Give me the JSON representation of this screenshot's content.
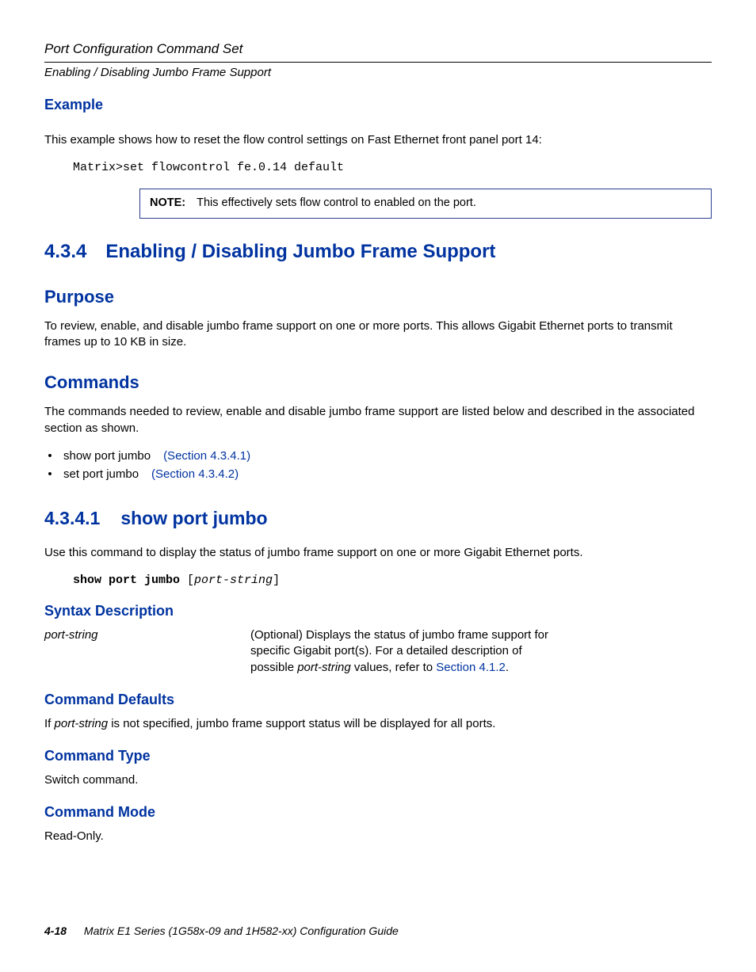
{
  "header": {
    "running_title": "Port Configuration Command Set",
    "running_sub": "Enabling / Disabling Jumbo Frame Support"
  },
  "example": {
    "heading": "Example",
    "text": "This example shows how to reset the flow control settings on Fast Ethernet front panel port 14:",
    "code": "Matrix>set flowcontrol fe.0.14 default",
    "note_label": "NOTE:",
    "note_body": "This effectively sets flow control to enabled on the port."
  },
  "section": {
    "num": "4.3.4",
    "title": "Enabling / Disabling Jumbo Frame Support"
  },
  "purpose": {
    "heading": "Purpose",
    "text": "To review, enable, and disable jumbo frame support on one or more ports. This allows Gigabit Ethernet ports to transmit frames up to 10 KB in size."
  },
  "commands": {
    "heading": "Commands",
    "intro": "The commands needed to review, enable and disable jumbo frame support are listed below and described in the associated section as shown.",
    "items": [
      {
        "bullet": "•",
        "text": "show port jumbo",
        "xref": "(Section 4.3.4.1)"
      },
      {
        "bullet": "•",
        "text": "set port jumbo",
        "xref": "(Section 4.3.4.2)"
      }
    ]
  },
  "cmd": {
    "num": "4.3.4.1",
    "title": "show port jumbo",
    "desc": "Use this command to display the status of jumbo frame support on one or more Gigabit Ethernet ports.",
    "syntax": "show port jumbo [port-string]"
  },
  "syntax_description": {
    "heading": "Syntax Description",
    "param": "port-string",
    "param_desc_l1": "(Optional) Displays the status of jumbo frame support for",
    "param_desc_l2": "specific Gigabit port(s). For a detailed description of",
    "param_desc_l3_a": "possible ",
    "param_desc_l3_i": "port-string",
    "param_desc_l3_b": " values, refer to ",
    "param_desc_l3_xref": "Section 4.1.2",
    "param_desc_l3_c": "."
  },
  "command_defaults": {
    "heading": "Command Defaults",
    "text_a": "If ",
    "text_i": "port-string",
    "text_b": " is not specified, jumbo frame support status will be displayed for all ports."
  },
  "command_type": {
    "heading": "Command Type",
    "text": "Switch command."
  },
  "command_mode": {
    "heading": "Command Mode",
    "text": "Read-Only."
  },
  "footer": {
    "page": "4-18",
    "guide": "Matrix E1 Series (1G58x-09 and 1H582-xx) Configuration Guide"
  }
}
